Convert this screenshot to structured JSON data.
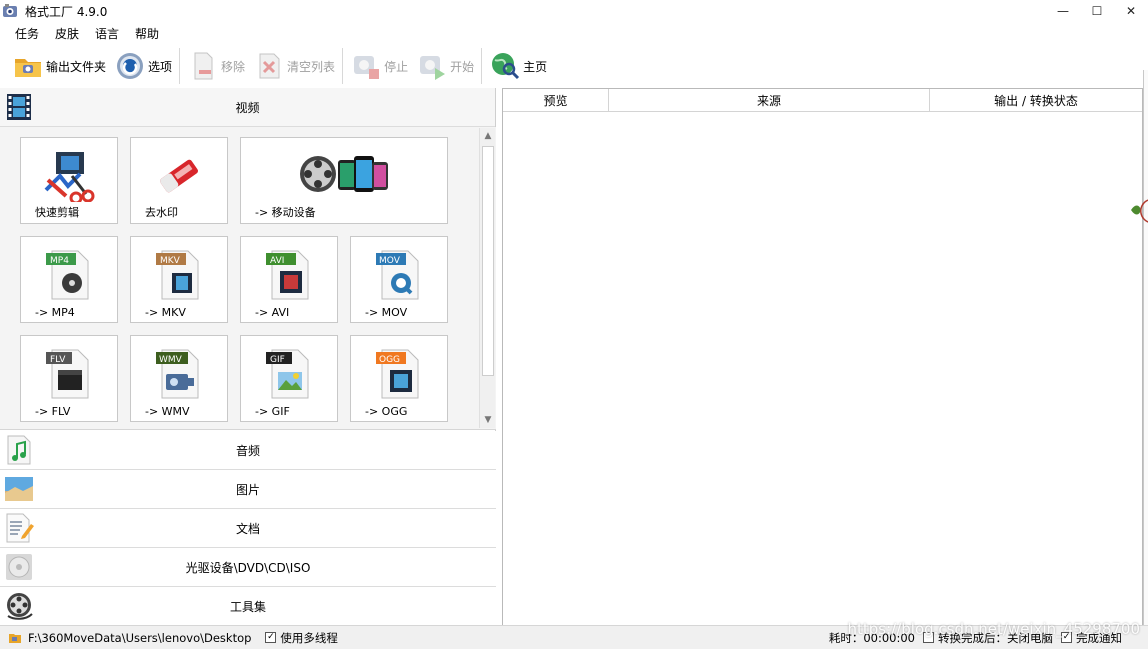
{
  "window": {
    "title": "格式工厂 4.9.0",
    "controls": {
      "minimize": "—",
      "maximize": "☐",
      "close": "✕"
    }
  },
  "menu": [
    "任务",
    "皮肤",
    "语言",
    "帮助"
  ],
  "toolbar": {
    "output_folder": "输出文件夹",
    "options": "选项",
    "remove": "移除",
    "clear_list": "清空列表",
    "stop": "停止",
    "start": "开始",
    "home": "主页"
  },
  "left": {
    "video_header": "视频",
    "tiles": [
      {
        "label": "快速剪辑",
        "icon": "scissors-film-icon"
      },
      {
        "label": "去水印",
        "icon": "eraser-icon"
      },
      {
        "label": "-> 移动设备",
        "icon": "mobile-devices-icon"
      },
      {
        "label": "-> MP4",
        "icon": "mp4-file-icon",
        "badge": "MP4"
      },
      {
        "label": "-> MKV",
        "icon": "mkv-file-icon",
        "badge": "MKV"
      },
      {
        "label": "-> AVI",
        "icon": "avi-file-icon",
        "badge": "AVI"
      },
      {
        "label": "-> MOV",
        "icon": "mov-file-icon",
        "badge": "MOV"
      },
      {
        "label": "-> FLV",
        "icon": "flv-file-icon",
        "badge": "FLV"
      },
      {
        "label": "-> WMV",
        "icon": "wmv-file-icon",
        "badge": "WMV"
      },
      {
        "label": "-> GIF",
        "icon": "gif-file-icon",
        "badge": "GIF"
      },
      {
        "label": "-> OGG",
        "icon": "ogg-file-icon",
        "badge": "OGG"
      }
    ],
    "categories": [
      "音频",
      "图片",
      "文档",
      "光驱设备\\DVD\\CD\\ISO",
      "工具集"
    ]
  },
  "right": {
    "columns": [
      "预览",
      "来源",
      "输出 / 转换状态"
    ]
  },
  "status": {
    "path": "F:\\360MoveData\\Users\\lenovo\\Desktop",
    "multithread": "使用多线程",
    "elapsed": "耗时：00:00:00",
    "shutdown_after": "转换完成后：关闭电脑",
    "notify": "完成通知"
  },
  "watermark": "https://blog.csdn.net/weixin_45298700",
  "colors": {
    "mp4": "#3c9a4a",
    "mkv": "#b07a45",
    "avi": "#3f8f2f",
    "mov": "#2d7ab5",
    "flv": "#555555",
    "wmv": "#3d5e1f",
    "gif": "#222222",
    "ogg": "#f07820"
  }
}
